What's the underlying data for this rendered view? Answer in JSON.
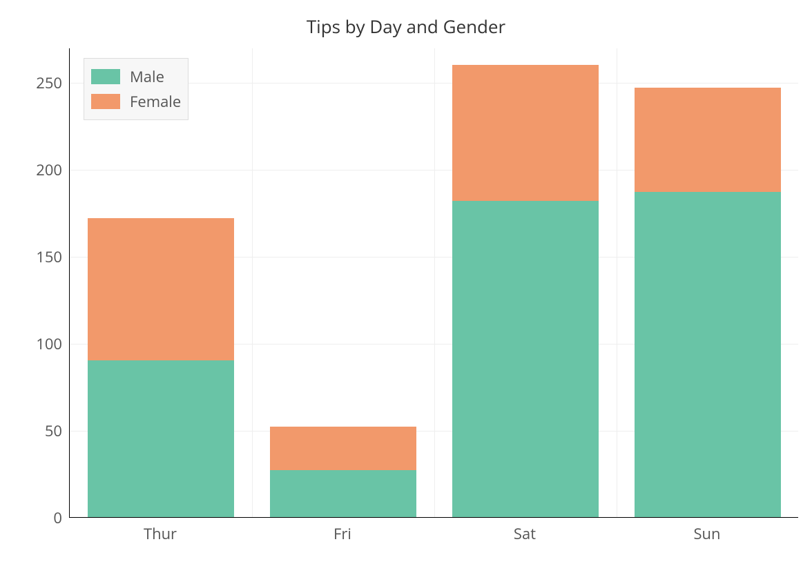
{
  "chart_data": {
    "type": "bar",
    "stacked": true,
    "title": "Tips by Day and Gender",
    "categories": [
      "Thur",
      "Fri",
      "Sat",
      "Sun"
    ],
    "series": [
      {
        "name": "Male",
        "values": [
          90,
          27,
          182,
          187
        ],
        "color": "#69c4a6"
      },
      {
        "name": "Female",
        "values": [
          82,
          25,
          78,
          60
        ],
        "color": "#f2996b"
      }
    ],
    "xlabel": "",
    "ylabel": "",
    "ylim": [
      0,
      270
    ],
    "y_ticks": [
      0,
      50,
      100,
      150,
      200,
      250
    ],
    "x_gridlines_between": true,
    "legend_position": "top-left"
  }
}
